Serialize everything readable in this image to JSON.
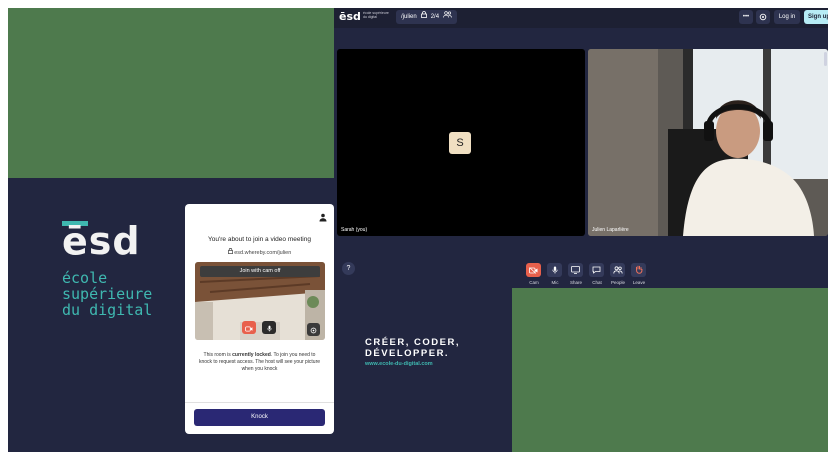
{
  "brand": {
    "logo_text": "ēsd",
    "school_lines": [
      "école",
      "supérieure",
      "du digital"
    ],
    "slogan_lines": [
      "CRÉER, CODER,",
      "DÉVELOPPER."
    ],
    "website": "www.ecole-du-digital.com"
  },
  "topbar": {
    "logo_text": "ēsd",
    "logo_sub": "école supérieure du digital",
    "room_name": "/julien",
    "participant_count": "2/4",
    "more_label": "•••",
    "login_label": "Log in",
    "signup_label": "Sign up"
  },
  "tiles": [
    {
      "name": "Sarah (you)",
      "avatar_letter": "S"
    },
    {
      "name": "Julien Laparlière"
    }
  ],
  "controls": [
    {
      "label": "Cam",
      "icon": "camera-off-icon"
    },
    {
      "label": "Mic",
      "icon": "mic-icon"
    },
    {
      "label": "Share",
      "icon": "screen-share-icon"
    },
    {
      "label": "Chat",
      "icon": "chat-icon"
    },
    {
      "label": "People",
      "icon": "people-icon"
    },
    {
      "label": "Leave",
      "icon": "leave-hand-icon"
    }
  ],
  "help_label": "?",
  "dialog": {
    "title": "You're about to join a video meeting",
    "url": "esd.whereby.com/julien",
    "cam_off_label": "Join with cam off",
    "message_before": "This room is ",
    "message_bold": "currently locked",
    "message_after": ". To join you need to knock to request access. The host will see your picture when you knock",
    "knock_label": "Knock"
  },
  "colors": {
    "navy": "#222640",
    "green": "#4e7a4d",
    "teal": "#3fb8b0",
    "cam_red": "#e8604c",
    "knock": "#2a2874"
  }
}
